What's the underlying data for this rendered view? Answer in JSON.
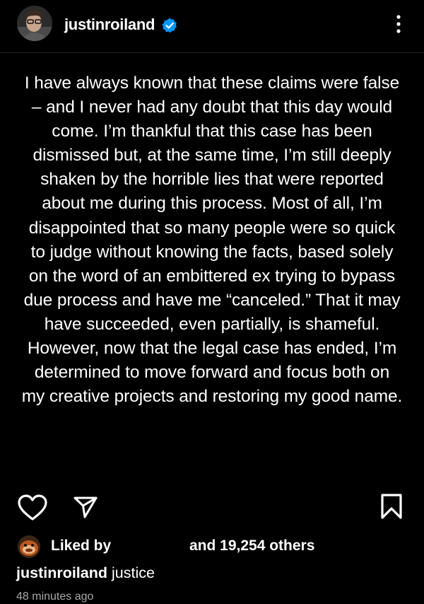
{
  "header": {
    "username": "justinroiland"
  },
  "post": {
    "text": "I have always known that these claims were false – and I never had any doubt that this day would come. I’m thankful that this case has been dismissed but, at the same time, I’m still deeply shaken by the horrible lies that were reported about me during this process. Most of all, I’m disappointed that so many people were so quick to judge without knowing the facts, based solely on the word of an embittered ex trying to bypass due process and have me “canceled.” That it may have succeeded, even partially, is shameful. However, now that the legal case has ended, I’m determined to move forward and focus both on my creative projects and restoring my good name."
  },
  "actions": {
    "like_icon": "heart-outline-icon",
    "share_icon": "send-icon",
    "save_icon": "bookmark-outline-icon"
  },
  "likes": {
    "liked_by": "Liked by",
    "others": "and 19,254 others"
  },
  "caption": {
    "username": "justinroiland",
    "text": "justice"
  },
  "timestamp": "48 minutes ago",
  "colors": {
    "background": "#000000",
    "text": "#ffffff",
    "verified": "#0095f6",
    "muted": "#a8a8a8"
  }
}
